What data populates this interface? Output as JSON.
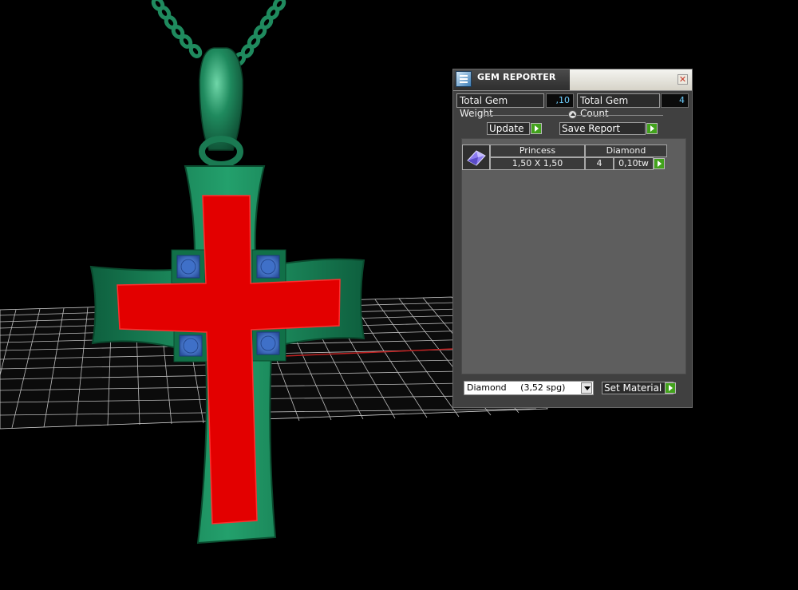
{
  "panel": {
    "title": "GEM REPORTER",
    "close_glyph": "✕",
    "total_weight_label": "Total Gem Weight",
    "total_weight_value": ",10",
    "total_count_label": "Total Gem Count",
    "total_count_value": "4",
    "update_label": "Update",
    "save_report_label": "Save Report",
    "table": {
      "headers": [
        "Princess",
        "Diamond"
      ],
      "row": {
        "size": "1,50 X 1,50",
        "count": "4",
        "weight": "0,10tw"
      }
    },
    "material_select": "Diamond     (3,52 spg)",
    "set_material_label": "Set Material"
  },
  "colors": {
    "metal": "#1f8a5e",
    "metal_dark": "#0f5a3a",
    "face": "#e00000",
    "gem": "#3d78d0",
    "grid": "#cfcfcf",
    "accent_go": "#42a21c",
    "value_text": "#6fd0ff"
  },
  "icons": [
    "app-icon",
    "close-icon",
    "slider-knob-icon",
    "go-arrow-icon",
    "gem-princess-icon",
    "dropdown-arrow-icon"
  ]
}
